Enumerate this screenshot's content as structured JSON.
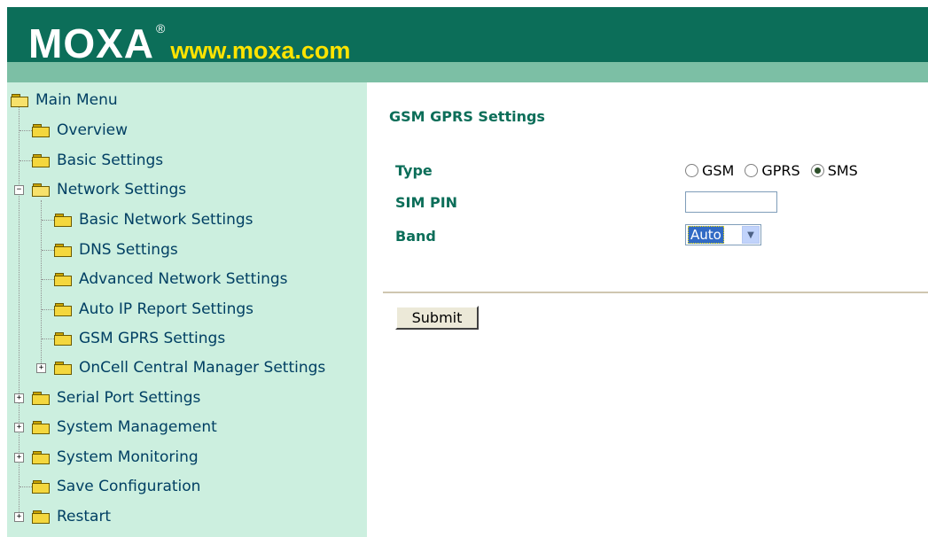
{
  "header": {
    "logo_text": "MOXA",
    "registered_mark": "®",
    "url": "www.moxa.com",
    "colors": {
      "band_dark": "#0c6e59",
      "band_light": "#7cbfa5",
      "url_yellow": "#ffe400"
    }
  },
  "nav": {
    "background": "#ccefdf",
    "items": [
      {
        "label": "Main Menu"
      },
      {
        "label": "Overview"
      },
      {
        "label": "Basic Settings"
      },
      {
        "label": "Network Settings"
      },
      {
        "label": "Basic Network Settings"
      },
      {
        "label": "DNS Settings"
      },
      {
        "label": "Advanced Network Settings"
      },
      {
        "label": "Auto IP Report Settings"
      },
      {
        "label": "GSM GPRS Settings"
      },
      {
        "label": "OnCell Central Manager Settings"
      },
      {
        "label": "Serial Port Settings"
      },
      {
        "label": "System Management"
      },
      {
        "label": "System Monitoring"
      },
      {
        "label": "Save Configuration"
      },
      {
        "label": "Restart"
      }
    ],
    "expander_plus": "+",
    "expander_minus": "−"
  },
  "content": {
    "title": "GSM GPRS Settings",
    "type_label": "Type",
    "type_options": [
      "GSM",
      "GPRS",
      "SMS"
    ],
    "type_selected": "SMS",
    "sim_pin_label": "SIM PIN",
    "sim_pin_value": "",
    "band_label": "Band",
    "band_value": "Auto",
    "submit_label": "Submit"
  }
}
